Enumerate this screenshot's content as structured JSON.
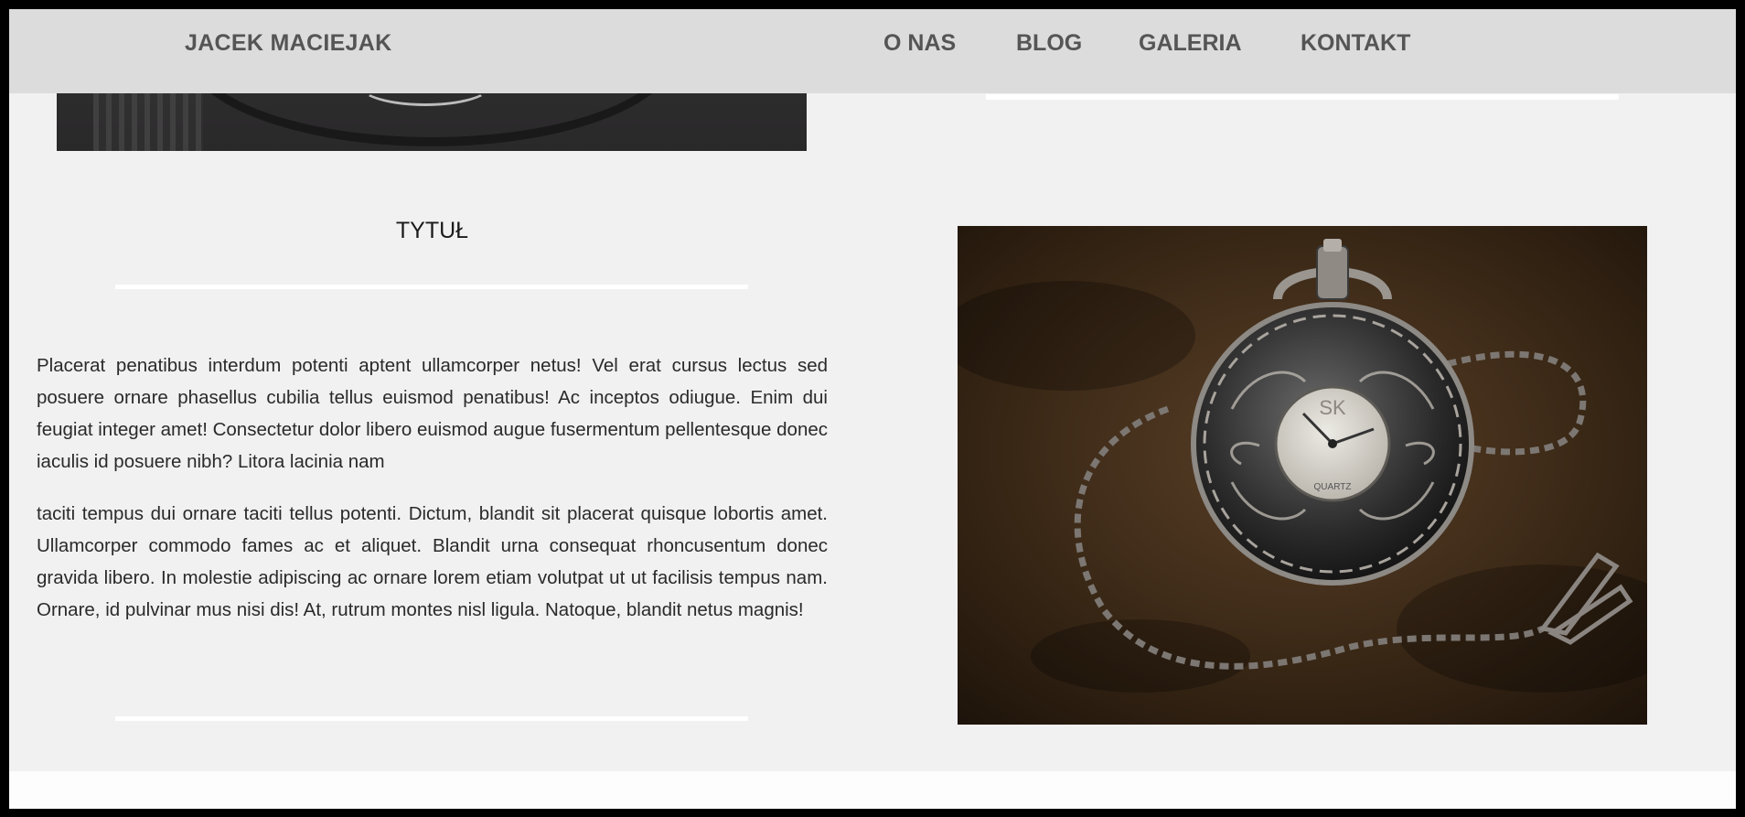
{
  "nav": {
    "brand": "JACEK MACIEJAK",
    "links": [
      "O NAS",
      "BLOG",
      "GALERIA",
      "KONTAKT"
    ]
  },
  "content": {
    "title": "TYTUŁ",
    "paragraphs": [
      "Placerat penatibus interdum potenti aptent ullamcorper netus! Vel erat cursus lectus sed posuere ornare phasellus cubilia tellus euismod penatibus! Ac inceptos odiugue. Enim dui feugiat integer amet! Consectetur dolor libero euismod augue fusermentum pellentesque donec iaculis id posuere nibh? Litora lacinia nam",
      "taciti tempus dui ornare taciti tellus potenti. Dictum, blandit sit placerat quisque lobortis amet. Ullamcorper commodo fames ac et aliquet. Blandit urna consequat rhoncusentum donec gravida libero. In molestie adipiscing ac ornare lorem etiam volutpat ut ut facilisis tempus nam. Ornare, id pulvinar mus nisi dis! At, rutrum montes nisl ligula. Natoque, blandit netus magnis!"
    ]
  },
  "photo": {
    "watch_brand": "SK",
    "watch_model": "QUARTZ"
  },
  "colors": {
    "navbar": "#dcdcdd",
    "page": "#f2f1f2",
    "nav_text": "#555556"
  }
}
